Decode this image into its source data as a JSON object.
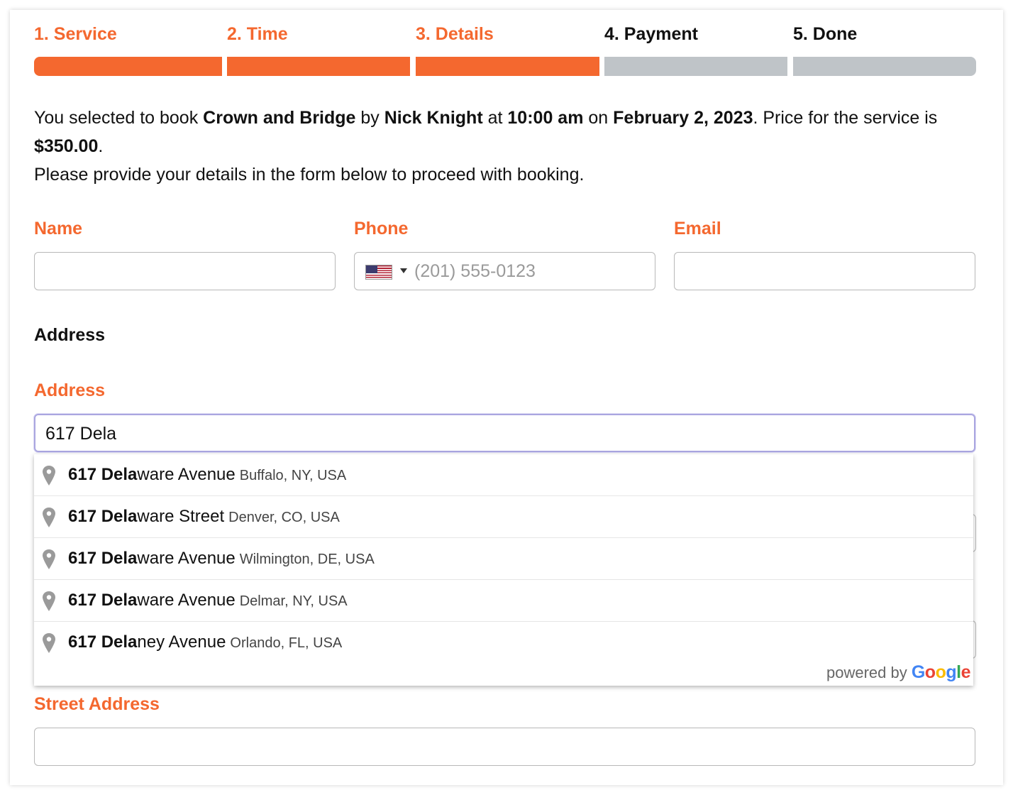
{
  "steps": [
    {
      "label": "1. Service",
      "state": "active"
    },
    {
      "label": "2. Time",
      "state": "active"
    },
    {
      "label": "3. Details",
      "state": "active"
    },
    {
      "label": "4. Payment",
      "state": "inactive"
    },
    {
      "label": "5. Done",
      "state": "inactive"
    }
  ],
  "colors": {
    "accent": "#f4682f",
    "inactive_bar": "#bfc4c8",
    "focus_border": "#aaa6e0"
  },
  "intro": {
    "t1": "You selected to book ",
    "service": "Crown and Bridge",
    "t2": " by ",
    "staff": "Nick Knight",
    "t3": " at ",
    "time": "10:00 am",
    "t4": " on ",
    "date": "February 2, 2023",
    "t5": ". Price for the service is ",
    "price": "$350.00",
    "t6": ".",
    "line2": "Please provide your details in the form below to proceed with booking."
  },
  "form": {
    "name_label": "Name",
    "name_value": "",
    "phone_label": "Phone",
    "phone_country_icon": "us-flag-icon",
    "phone_placeholder": "(201) 555-0123",
    "email_label": "Email",
    "email_value": "",
    "address_section_heading": "Address",
    "address_label": "Address",
    "address_value": "617 Dela",
    "street_label": "Street Address",
    "street_value": ""
  },
  "autocomplete": {
    "suggestions": [
      {
        "match": "617 Dela",
        "rest": "ware Avenue",
        "secondary": "Buffalo, NY, USA"
      },
      {
        "match": "617 Dela",
        "rest": "ware Street",
        "secondary": "Denver, CO, USA"
      },
      {
        "match": "617 Dela",
        "rest": "ware Avenue",
        "secondary": "Wilmington, DE, USA"
      },
      {
        "match": "617 Dela",
        "rest": "ware Avenue",
        "secondary": "Delmar, NY, USA"
      },
      {
        "match": "617 Dela",
        "rest": "ney Avenue",
        "secondary": "Orlando, FL, USA"
      }
    ],
    "icon": "map-pin-icon",
    "powered_by": "powered by",
    "brand": [
      "G",
      "o",
      "o",
      "g",
      "l",
      "e"
    ]
  }
}
